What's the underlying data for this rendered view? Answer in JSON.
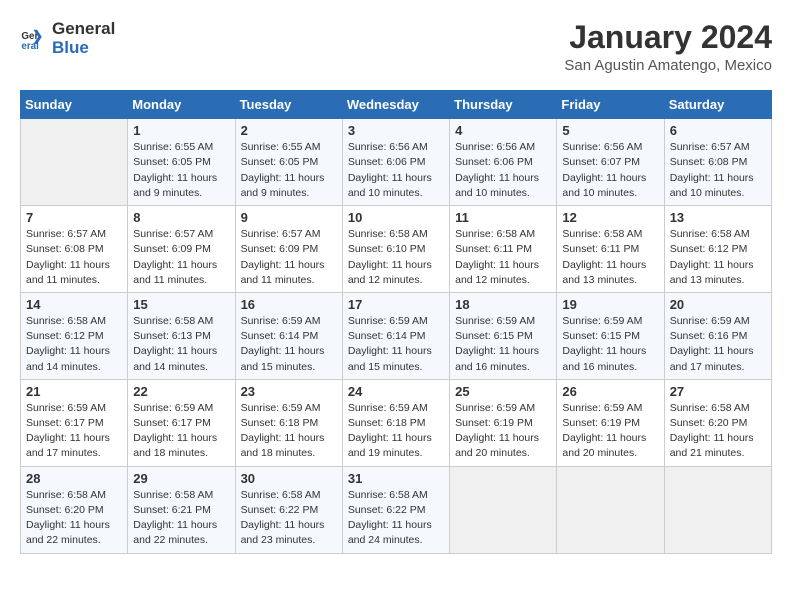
{
  "logo": {
    "general": "General",
    "blue": "Blue"
  },
  "title": {
    "month_year": "January 2024",
    "location": "San Agustin Amatengo, Mexico"
  },
  "headers": [
    "Sunday",
    "Monday",
    "Tuesday",
    "Wednesday",
    "Thursday",
    "Friday",
    "Saturday"
  ],
  "weeks": [
    [
      {
        "day": "",
        "info": ""
      },
      {
        "day": "1",
        "info": "Sunrise: 6:55 AM\nSunset: 6:05 PM\nDaylight: 11 hours and 9 minutes."
      },
      {
        "day": "2",
        "info": "Sunrise: 6:55 AM\nSunset: 6:05 PM\nDaylight: 11 hours and 9 minutes."
      },
      {
        "day": "3",
        "info": "Sunrise: 6:56 AM\nSunset: 6:06 PM\nDaylight: 11 hours and 10 minutes."
      },
      {
        "day": "4",
        "info": "Sunrise: 6:56 AM\nSunset: 6:06 PM\nDaylight: 11 hours and 10 minutes."
      },
      {
        "day": "5",
        "info": "Sunrise: 6:56 AM\nSunset: 6:07 PM\nDaylight: 11 hours and 10 minutes."
      },
      {
        "day": "6",
        "info": "Sunrise: 6:57 AM\nSunset: 6:08 PM\nDaylight: 11 hours and 10 minutes."
      }
    ],
    [
      {
        "day": "7",
        "info": "Sunrise: 6:57 AM\nSunset: 6:08 PM\nDaylight: 11 hours and 11 minutes."
      },
      {
        "day": "8",
        "info": "Sunrise: 6:57 AM\nSunset: 6:09 PM\nDaylight: 11 hours and 11 minutes."
      },
      {
        "day": "9",
        "info": "Sunrise: 6:57 AM\nSunset: 6:09 PM\nDaylight: 11 hours and 11 minutes."
      },
      {
        "day": "10",
        "info": "Sunrise: 6:58 AM\nSunset: 6:10 PM\nDaylight: 11 hours and 12 minutes."
      },
      {
        "day": "11",
        "info": "Sunrise: 6:58 AM\nSunset: 6:11 PM\nDaylight: 11 hours and 12 minutes."
      },
      {
        "day": "12",
        "info": "Sunrise: 6:58 AM\nSunset: 6:11 PM\nDaylight: 11 hours and 13 minutes."
      },
      {
        "day": "13",
        "info": "Sunrise: 6:58 AM\nSunset: 6:12 PM\nDaylight: 11 hours and 13 minutes."
      }
    ],
    [
      {
        "day": "14",
        "info": "Sunrise: 6:58 AM\nSunset: 6:12 PM\nDaylight: 11 hours and 14 minutes."
      },
      {
        "day": "15",
        "info": "Sunrise: 6:58 AM\nSunset: 6:13 PM\nDaylight: 11 hours and 14 minutes."
      },
      {
        "day": "16",
        "info": "Sunrise: 6:59 AM\nSunset: 6:14 PM\nDaylight: 11 hours and 15 minutes."
      },
      {
        "day": "17",
        "info": "Sunrise: 6:59 AM\nSunset: 6:14 PM\nDaylight: 11 hours and 15 minutes."
      },
      {
        "day": "18",
        "info": "Sunrise: 6:59 AM\nSunset: 6:15 PM\nDaylight: 11 hours and 16 minutes."
      },
      {
        "day": "19",
        "info": "Sunrise: 6:59 AM\nSunset: 6:15 PM\nDaylight: 11 hours and 16 minutes."
      },
      {
        "day": "20",
        "info": "Sunrise: 6:59 AM\nSunset: 6:16 PM\nDaylight: 11 hours and 17 minutes."
      }
    ],
    [
      {
        "day": "21",
        "info": "Sunrise: 6:59 AM\nSunset: 6:17 PM\nDaylight: 11 hours and 17 minutes."
      },
      {
        "day": "22",
        "info": "Sunrise: 6:59 AM\nSunset: 6:17 PM\nDaylight: 11 hours and 18 minutes."
      },
      {
        "day": "23",
        "info": "Sunrise: 6:59 AM\nSunset: 6:18 PM\nDaylight: 11 hours and 18 minutes."
      },
      {
        "day": "24",
        "info": "Sunrise: 6:59 AM\nSunset: 6:18 PM\nDaylight: 11 hours and 19 minutes."
      },
      {
        "day": "25",
        "info": "Sunrise: 6:59 AM\nSunset: 6:19 PM\nDaylight: 11 hours and 20 minutes."
      },
      {
        "day": "26",
        "info": "Sunrise: 6:59 AM\nSunset: 6:19 PM\nDaylight: 11 hours and 20 minutes."
      },
      {
        "day": "27",
        "info": "Sunrise: 6:58 AM\nSunset: 6:20 PM\nDaylight: 11 hours and 21 minutes."
      }
    ],
    [
      {
        "day": "28",
        "info": "Sunrise: 6:58 AM\nSunset: 6:20 PM\nDaylight: 11 hours and 22 minutes."
      },
      {
        "day": "29",
        "info": "Sunrise: 6:58 AM\nSunset: 6:21 PM\nDaylight: 11 hours and 22 minutes."
      },
      {
        "day": "30",
        "info": "Sunrise: 6:58 AM\nSunset: 6:22 PM\nDaylight: 11 hours and 23 minutes."
      },
      {
        "day": "31",
        "info": "Sunrise: 6:58 AM\nSunset: 6:22 PM\nDaylight: 11 hours and 24 minutes."
      },
      {
        "day": "",
        "info": ""
      },
      {
        "day": "",
        "info": ""
      },
      {
        "day": "",
        "info": ""
      }
    ]
  ]
}
